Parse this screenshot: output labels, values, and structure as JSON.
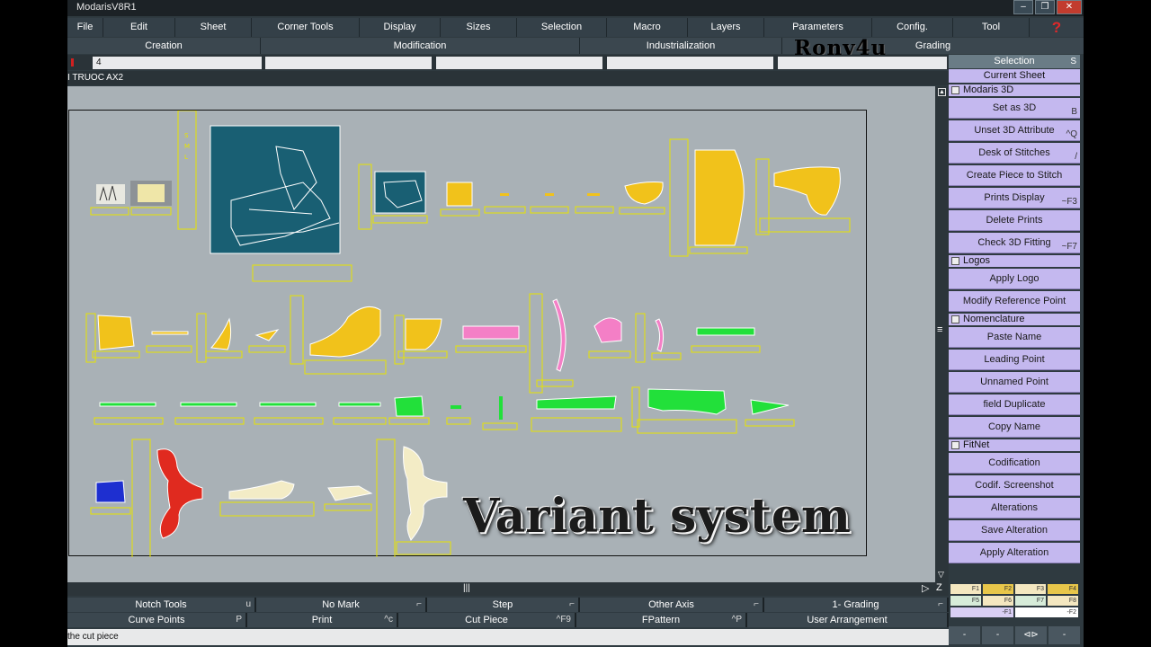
{
  "app": {
    "title": "ModarisV8R1",
    "window_buttons": [
      "–",
      "❐",
      "✕"
    ]
  },
  "menu": [
    {
      "label": "File"
    },
    {
      "label": "Edit"
    },
    {
      "label": "Sheet"
    },
    {
      "label": "Corner Tools"
    },
    {
      "label": "Display"
    },
    {
      "label": "Sizes"
    },
    {
      "label": "Selection"
    },
    {
      "label": "Macro"
    },
    {
      "label": "Layers"
    },
    {
      "label": "Parameters"
    },
    {
      "label": "Config."
    },
    {
      "label": "Tool"
    }
  ],
  "help_icon": "?",
  "submenu": [
    {
      "label": "Creation"
    },
    {
      "label": "Modification"
    },
    {
      "label": "Industrialization"
    },
    {
      "label": "Grading"
    }
  ],
  "toolbar": {
    "field_value": "4"
  },
  "path_text": "I TRUOC AX2",
  "watermark": "Rony4u",
  "overlay_caption": "Variant system",
  "canvas": {
    "hscroll_glyph": "|||",
    "vscroll_glyph": "≡",
    "zoom_icon": "Z",
    "play_icon": "▷"
  },
  "bottom_row1": [
    {
      "label": "Notch Tools",
      "shortcut": "u"
    },
    {
      "label": "No Mark",
      "shortcut": "⌐"
    },
    {
      "label": "Step",
      "shortcut": "⌐"
    },
    {
      "label": "Other Axis",
      "shortcut": "⌐"
    },
    {
      "label": "1- Grading",
      "shortcut": "⌐"
    }
  ],
  "bottom_row2": [
    {
      "label": "Curve Points",
      "shortcut": "P"
    },
    {
      "label": "Print",
      "shortcut": "^c"
    },
    {
      "label": "Cut Piece",
      "shortcut": "^F9"
    },
    {
      "label": "FPattern",
      "shortcut": "^P"
    },
    {
      "label": "User Arrangement",
      "shortcut": ""
    }
  ],
  "status_text": "the cut piece",
  "panel": {
    "header": "Selection",
    "header_key": "S",
    "current": "Current Sheet",
    "groups": [
      {
        "title": "Modaris 3D",
        "items": [
          {
            "label": "Set as 3D",
            "shortcut": "B"
          },
          {
            "label": "Unset 3D Attribute",
            "shortcut": "^Q"
          },
          {
            "label": "Desk of Stitches",
            "shortcut": "/"
          },
          {
            "label": "Create Piece to Stitch",
            "shortcut": ""
          },
          {
            "label": "Prints Display",
            "shortcut": "~F3"
          },
          {
            "label": "Delete Prints",
            "shortcut": ""
          },
          {
            "label": "Check 3D Fitting",
            "shortcut": "~F7"
          }
        ]
      },
      {
        "title": "Logos",
        "items": [
          {
            "label": "Apply Logo",
            "shortcut": ""
          },
          {
            "label": "Modify Reference Point",
            "shortcut": ""
          }
        ]
      },
      {
        "title": "Nomenclature",
        "items": [
          {
            "label": "Paste Name",
            "shortcut": ""
          },
          {
            "label": "Leading Point",
            "shortcut": ""
          },
          {
            "label": "Unnamed Point",
            "shortcut": ""
          },
          {
            "label": "field Duplicate",
            "shortcut": ""
          },
          {
            "label": "Copy Name",
            "shortcut": ""
          }
        ]
      },
      {
        "title": "FitNet",
        "items": [
          {
            "label": "Codification",
            "shortcut": ""
          },
          {
            "label": "Codif. Screenshot",
            "shortcut": ""
          },
          {
            "label": "Alterations",
            "shortcut": ""
          },
          {
            "label": "Save Alteration",
            "shortcut": ""
          },
          {
            "label": "Apply Alteration",
            "shortcut": ""
          }
        ]
      }
    ],
    "grade_cells": [
      "F1",
      "F2",
      "F3",
      "F4",
      "F5",
      "F6",
      "F7",
      "F8",
      "-F1",
      "-F2"
    ],
    "nav": [
      "-",
      "-",
      "⊲⊳",
      "-"
    ]
  },
  "colors": {
    "piece_yellow": "#f1c21b",
    "piece_pink": "#f47fc6",
    "piece_green": "#22e03a",
    "piece_red": "#e02a1f",
    "piece_blue": "#1e2fd0",
    "piece_cream": "#f3ecc6",
    "panel_lilac": "#c4b8ef",
    "canvas_gray": "#a9b1b6",
    "teal": "#195f73"
  }
}
